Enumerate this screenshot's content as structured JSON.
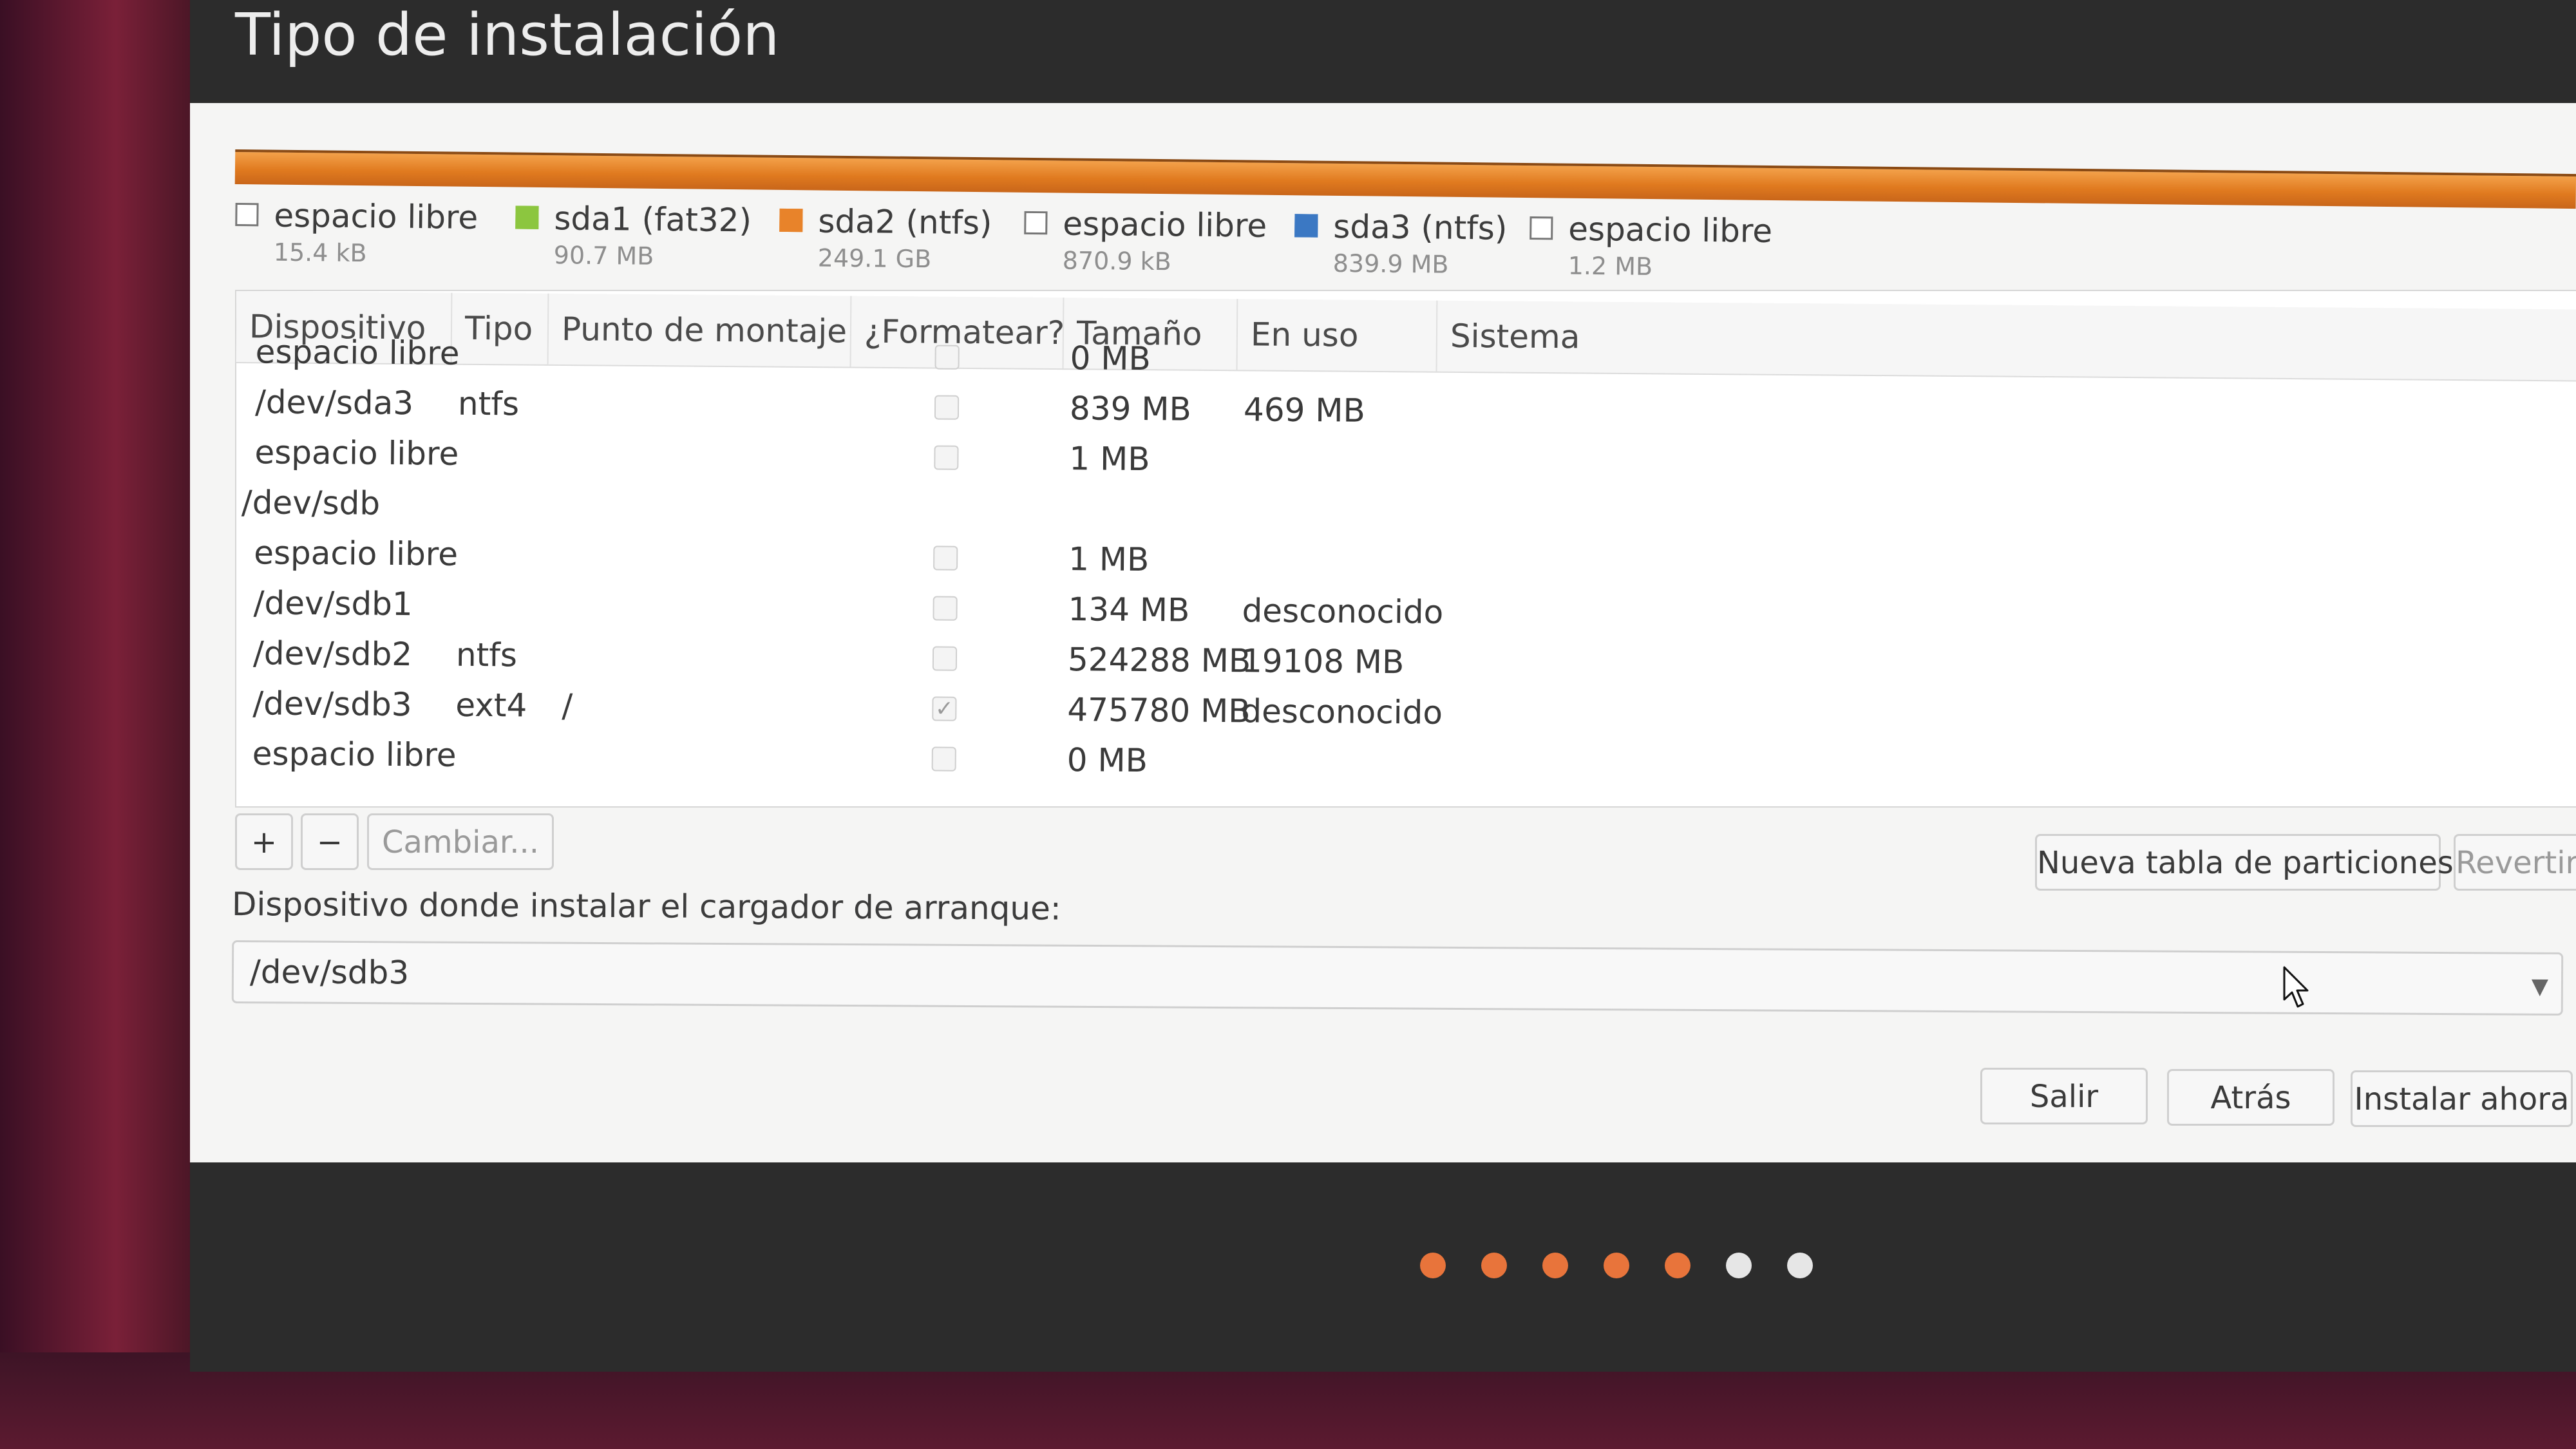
{
  "window": {
    "title": "Tipo de instalación"
  },
  "partitions_legend": [
    {
      "name": "espacio libre",
      "size": "15.4 kB",
      "color": "#ffffff"
    },
    {
      "name": "sda1 (fat32)",
      "size": "90.7 MB",
      "color": "#8cc63f"
    },
    {
      "name": "sda2 (ntfs)",
      "size": "249.1 GB",
      "color": "#e8832a"
    },
    {
      "name": "espacio libre",
      "size": "870.9 kB",
      "color": "#ffffff"
    },
    {
      "name": "sda3 (ntfs)",
      "size": "839.9 MB",
      "color": "#3b78c3"
    },
    {
      "name": "espacio libre",
      "size": "1.2 MB",
      "color": "#ffffff"
    }
  ],
  "table": {
    "headers": [
      "Dispositivo",
      "Tipo",
      "Punto de montaje",
      "¿Formatear?",
      "Tamaño",
      "En uso",
      "Sistema"
    ],
    "rows": [
      {
        "device": "espacio libre",
        "type": "",
        "mount": "",
        "format": false,
        "size": "0 MB",
        "used": "",
        "system": ""
      },
      {
        "device": "/dev/sda3",
        "type": "ntfs",
        "mount": "",
        "format": false,
        "size": "839 MB",
        "used": "469 MB",
        "system": ""
      },
      {
        "device": "espacio libre",
        "type": "",
        "mount": "",
        "format": false,
        "size": "1 MB",
        "used": "",
        "system": ""
      },
      {
        "device": "/dev/sdb",
        "type": "",
        "mount": "",
        "format": null,
        "size": "",
        "used": "",
        "system": ""
      },
      {
        "device": "espacio libre",
        "type": "",
        "mount": "",
        "format": false,
        "size": "1 MB",
        "used": "",
        "system": ""
      },
      {
        "device": "/dev/sdb1",
        "type": "",
        "mount": "",
        "format": false,
        "size": "134 MB",
        "used": "desconocido",
        "system": ""
      },
      {
        "device": "/dev/sdb2",
        "type": "ntfs",
        "mount": "",
        "format": false,
        "size": "524288 MB",
        "used": "19108 MB",
        "system": ""
      },
      {
        "device": "/dev/sdb3",
        "type": "ext4",
        "mount": "/",
        "format": true,
        "size": "475780 MB",
        "used": "desconocido",
        "system": ""
      },
      {
        "device": "espacio libre",
        "type": "",
        "mount": "",
        "format": false,
        "size": "0 MB",
        "used": "",
        "system": ""
      }
    ]
  },
  "table_buttons": {
    "add": "+",
    "remove": "−",
    "change": "Cambiar..."
  },
  "partition_buttons": {
    "new_table": "Nueva tabla de particiones...",
    "revert": "Revertir"
  },
  "bootloader": {
    "label": "Dispositivo donde instalar el cargador de arranque:",
    "value": "/dev/sdb3"
  },
  "nav_buttons": {
    "quit": "Salir",
    "back": "Atrás",
    "install": "Instalar ahora"
  },
  "progress": {
    "total_steps": 7,
    "completed_steps": 5,
    "done_color": "#e8743b",
    "todo_color": "#e6e6e6"
  }
}
